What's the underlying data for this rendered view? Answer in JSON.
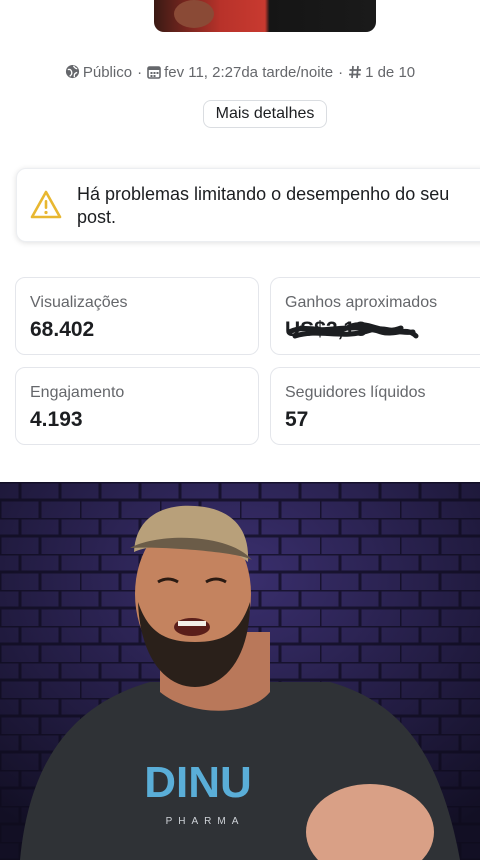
{
  "post_meta": {
    "visibility": "Público",
    "date": "fev 11, 2:27da tarde/noite",
    "position": "1 de 10",
    "separator": "·"
  },
  "details_button": "Mais detalhes",
  "warning": {
    "text": "Há problemas limitando o desempenho do seu post.",
    "icon": "warning-triangle-icon"
  },
  "stats": {
    "views": {
      "label": "Visualizações",
      "value": "68.402"
    },
    "earnings": {
      "label": "Ganhos aproximados",
      "value": "US$2,13"
    },
    "engagement": {
      "label": "Engajamento",
      "value": "4.193"
    },
    "followers": {
      "label": "Seguidores líquidos",
      "value": "57"
    }
  },
  "video": {
    "shirt_text": "DINU",
    "shirt_subtext": "PHARMA"
  },
  "colors": {
    "accent_warning": "#e8b730",
    "muted_text": "#65676b",
    "brick_wall": "#2a2250",
    "shirt_logo": "#5aaed8"
  }
}
